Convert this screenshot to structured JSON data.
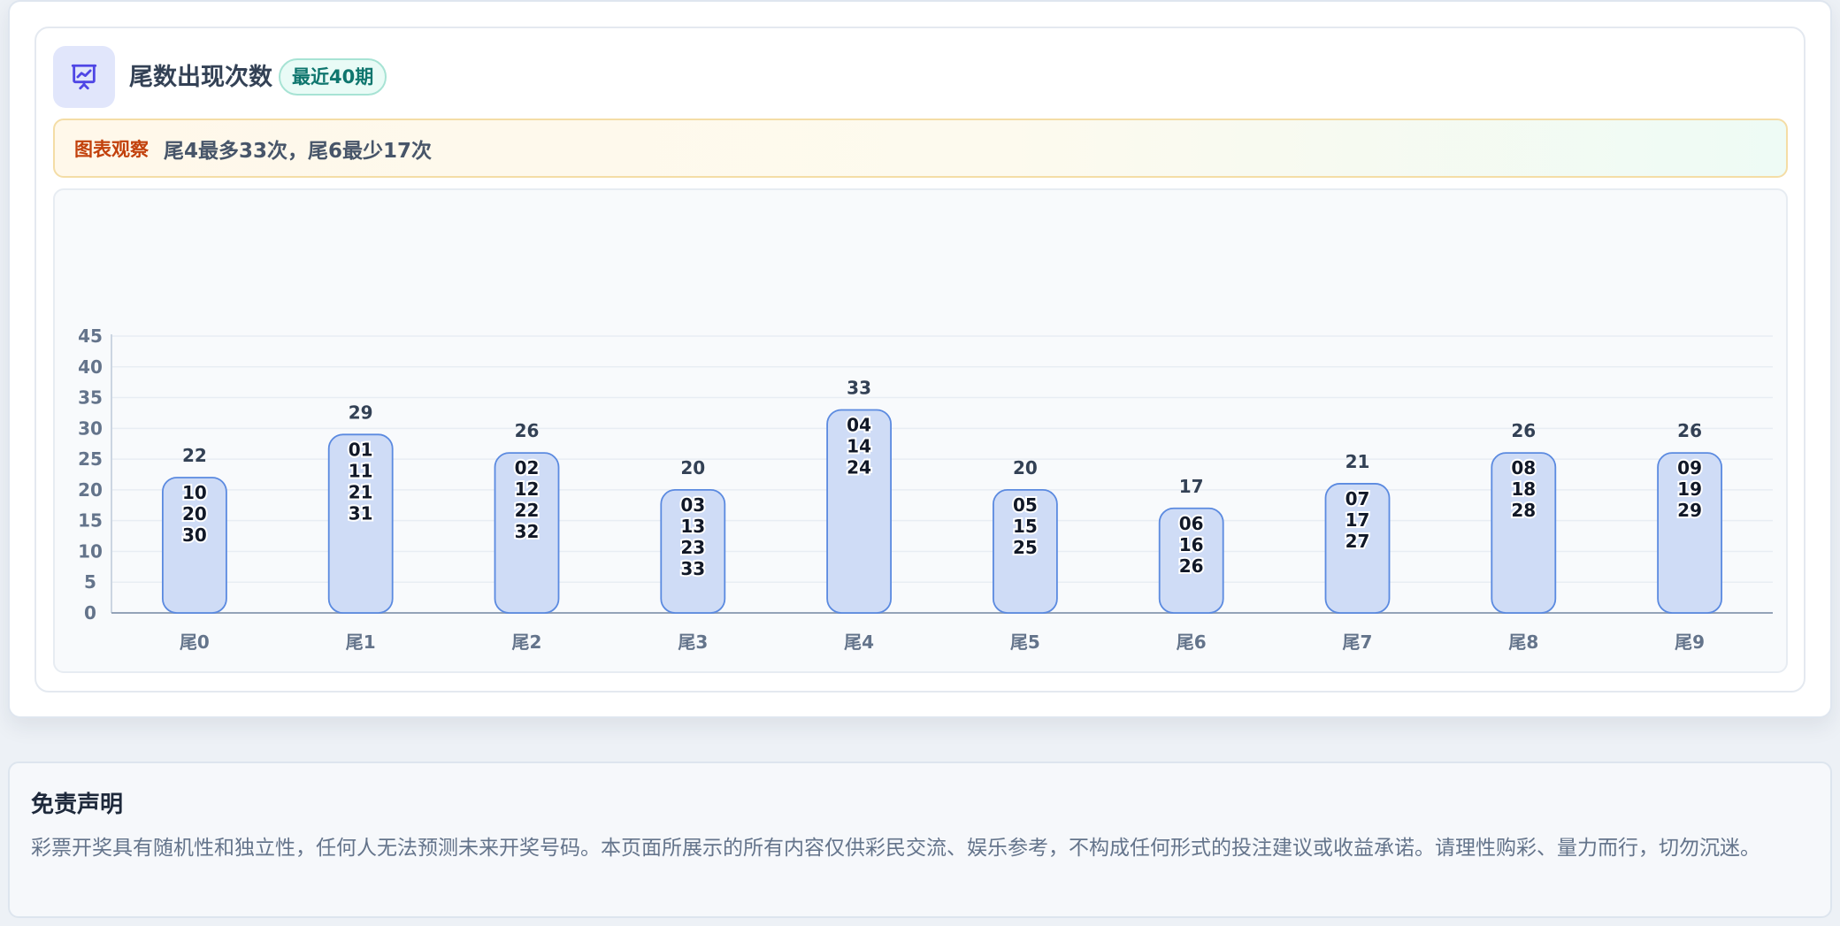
{
  "header": {
    "icon": "presentation-chart-icon",
    "title": "尾数出现次数",
    "badge": "最近40期"
  },
  "observation": {
    "label": "图表观察",
    "text": "尾4最多33次，尾6最少17次"
  },
  "colors": {
    "bar_fill": "#cfdcf6",
    "bar_stroke": "#5b8ae0",
    "accent": "#4f46e5",
    "badge_text": "#0f766e",
    "observe_label": "#c2410c"
  },
  "chart_data": {
    "type": "bar",
    "categories": [
      "尾0",
      "尾1",
      "尾2",
      "尾3",
      "尾4",
      "尾5",
      "尾6",
      "尾7",
      "尾8",
      "尾9"
    ],
    "values": [
      22,
      29,
      26,
      20,
      33,
      20,
      17,
      21,
      26,
      26
    ],
    "numbers": [
      [
        "10",
        "20",
        "30"
      ],
      [
        "01",
        "11",
        "21",
        "31"
      ],
      [
        "02",
        "12",
        "22",
        "32"
      ],
      [
        "03",
        "13",
        "23",
        "33"
      ],
      [
        "04",
        "14",
        "24"
      ],
      [
        "05",
        "15",
        "25"
      ],
      [
        "06",
        "16",
        "26"
      ],
      [
        "07",
        "17",
        "27"
      ],
      [
        "08",
        "18",
        "28"
      ],
      [
        "09",
        "19",
        "29"
      ]
    ],
    "yticks": [
      0,
      5,
      10,
      15,
      20,
      25,
      30,
      35,
      40,
      45
    ],
    "ylim": [
      0,
      45
    ],
    "grid": true
  },
  "disclaimer": {
    "title": "免责声明",
    "text": "彩票开奖具有随机性和独立性，任何人无法预测未来开奖号码。本页面所展示的所有内容仅供彩民交流、娱乐参考，不构成任何形式的投注建议或收益承诺。请理性购彩、量力而行，切勿沉迷。"
  }
}
